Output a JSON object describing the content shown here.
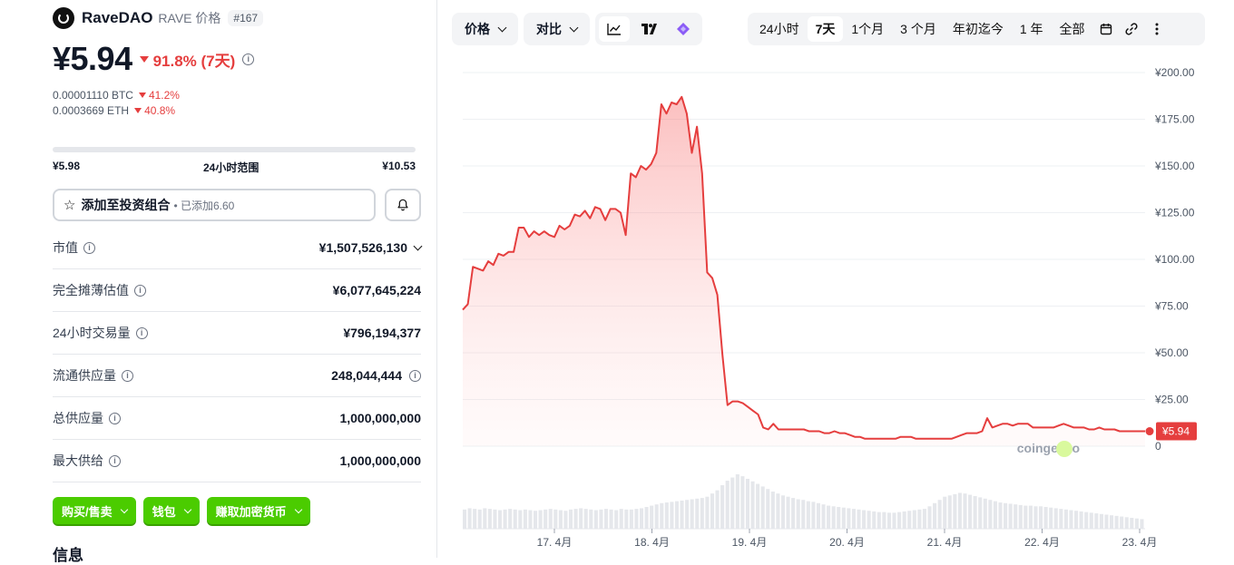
{
  "coin": {
    "name": "RaveDAO",
    "symbol_label": "RAVE 价格",
    "rank": "#167",
    "price": "¥5.94",
    "change": "91.8% (7天)",
    "btc_price": "0.00001110 BTC",
    "btc_change": "41.2%",
    "eth_price": "0.0003669 ETH",
    "eth_change": "40.8%"
  },
  "range24h": {
    "low": "¥5.98",
    "label": "24小时范围",
    "high": "¥10.53"
  },
  "portfolio": {
    "add_label": "添加至投资组合",
    "added_text": "• 已添加6.60"
  },
  "stats": [
    {
      "label": "市值",
      "value": "¥1,507,526,130"
    },
    {
      "label": "完全摊薄估值",
      "value": "¥6,077,645,224"
    },
    {
      "label": "24小时交易量",
      "value": "¥796,194,377"
    },
    {
      "label": "流通供应量",
      "value": "248,044,444"
    },
    {
      "label": "总供应量",
      "value": "1,000,000,000"
    },
    {
      "label": "最大供给",
      "value": "1,000,000,000"
    }
  ],
  "actions": {
    "buy_sell": "购买/售卖",
    "wallet": "钱包",
    "earn": "赚取加密货币"
  },
  "info_heading": "信息",
  "toolbar": {
    "price_label": "价格",
    "compare_label": "对比",
    "ranges": [
      "24小时",
      "7天",
      "1个月",
      "3 个月",
      "年初迄今",
      "1 年",
      "全部"
    ],
    "active_range": "7天"
  },
  "colors": {
    "accent_red": "#e53e3e",
    "green": "#4bcc00"
  },
  "chart_data": {
    "type": "area",
    "x_ticks": [
      "17. 4月",
      "18. 4月",
      "19. 4月",
      "20. 4月",
      "21. 4月",
      "22. 4月",
      "23. 4月"
    ],
    "y_ticks": [
      "¥200.00",
      "¥175.00",
      "¥150.00",
      "¥125.00",
      "¥100.00",
      "¥75.00",
      "¥50.00",
      "¥25.00",
      "0"
    ],
    "ylim": [
      0,
      200
    ],
    "last_price_label": "¥5.94",
    "watermark": "coingecko",
    "values": [
      73,
      76,
      96,
      95,
      94,
      99,
      97,
      103,
      102,
      104,
      104,
      117,
      117,
      112,
      115,
      113,
      115,
      113,
      112,
      118,
      116,
      118,
      124,
      123,
      126,
      122,
      128,
      127,
      121,
      127,
      127,
      125,
      113,
      146,
      144,
      150,
      148,
      151,
      157,
      183,
      178,
      184,
      183,
      187,
      178,
      157,
      171,
      146,
      93,
      90,
      81,
      49,
      22,
      24,
      24,
      23,
      21,
      19,
      17,
      10,
      9,
      12,
      9,
      9,
      9,
      9,
      9,
      9,
      8,
      8,
      8,
      7,
      7,
      8,
      7,
      7,
      6,
      5,
      5,
      4,
      4,
      4,
      4,
      4,
      4,
      4,
      5,
      5,
      5,
      4,
      4,
      4,
      4,
      4,
      4,
      4,
      4,
      5,
      6,
      7,
      7,
      7,
      8,
      15,
      10,
      11,
      12,
      12,
      11,
      12,
      12,
      12,
      10,
      10,
      10,
      10,
      10,
      11,
      12,
      11,
      10,
      10,
      10,
      9,
      9,
      10,
      9,
      9,
      9,
      8,
      8,
      8,
      8,
      8,
      8
    ],
    "volume": [
      30,
      32,
      31,
      30,
      32,
      31,
      30,
      29,
      30,
      31,
      30,
      29,
      30,
      29,
      28,
      29,
      30,
      31,
      30,
      29,
      28,
      30,
      31,
      32,
      31,
      30,
      29,
      30,
      31,
      30,
      29,
      31,
      30,
      30,
      31,
      32,
      34,
      36,
      38,
      40,
      41,
      42,
      43,
      44,
      45,
      46,
      47,
      48,
      50,
      55,
      60,
      68,
      75,
      80,
      85,
      82,
      78,
      74,
      70,
      66,
      62,
      58,
      55,
      52,
      50,
      48,
      46,
      45,
      43,
      42,
      40,
      38,
      36,
      35,
      34,
      33,
      32,
      31,
      30,
      29,
      28,
      27,
      26,
      26,
      25,
      25,
      26,
      27,
      28,
      29,
      30,
      31,
      35,
      40,
      45,
      50,
      52,
      54,
      56,
      55,
      53,
      51,
      49,
      47,
      45,
      43,
      41,
      40,
      39,
      38,
      37,
      36,
      36,
      35,
      35,
      34,
      33,
      32,
      31,
      30,
      29,
      28,
      27,
      26,
      25,
      24,
      23,
      22,
      21,
      20,
      19,
      18,
      17,
      16,
      15
    ]
  }
}
